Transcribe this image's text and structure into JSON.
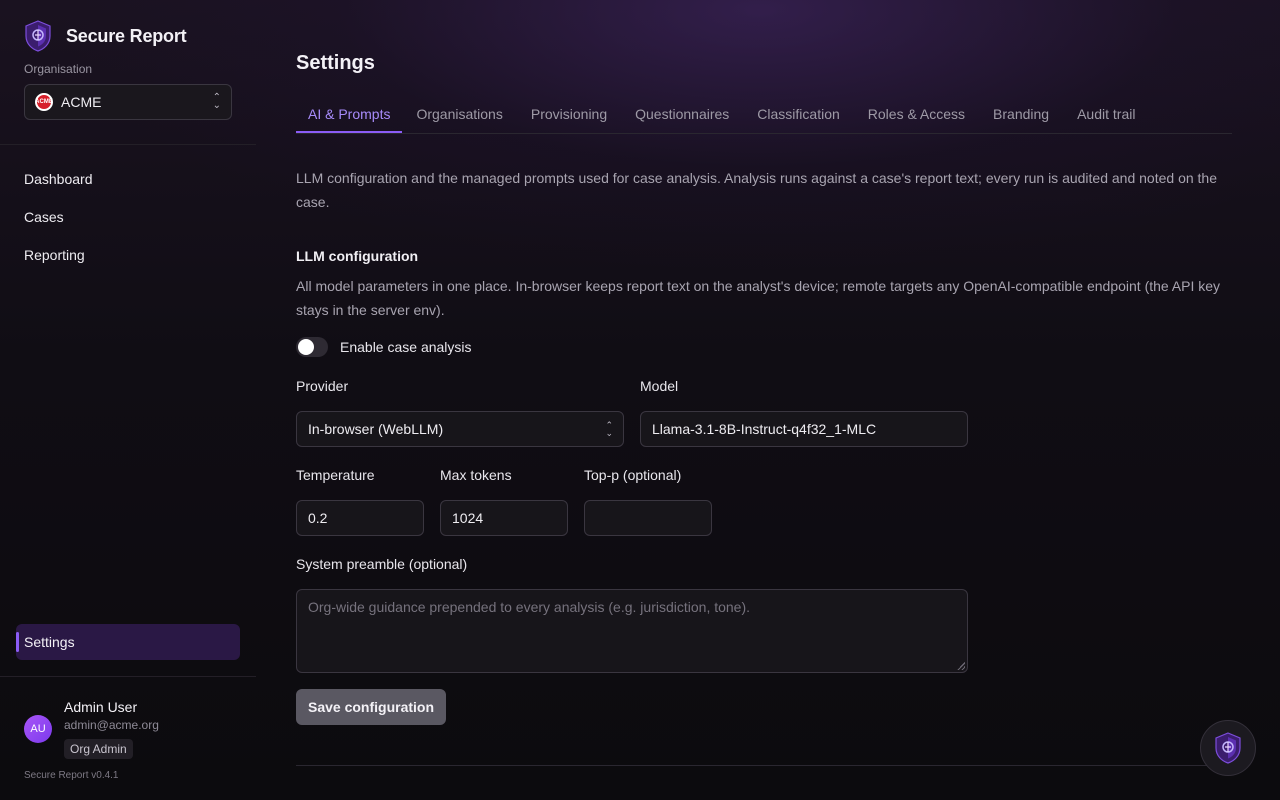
{
  "brand": {
    "name": "Secure Report"
  },
  "sidebar": {
    "org_label": "Organisation",
    "org_selected": "ACME",
    "org_badge_text": "ACME",
    "nav": [
      {
        "label": "Dashboard"
      },
      {
        "label": "Cases"
      },
      {
        "label": "Reporting"
      }
    ],
    "settings_label": "Settings",
    "user": {
      "initials": "AU",
      "name": "Admin User",
      "email": "admin@acme.org",
      "role": "Org Admin"
    },
    "version": "Secure Report v0.4.1"
  },
  "main": {
    "title": "Settings",
    "tabs": [
      {
        "label": "AI & Prompts",
        "active": true
      },
      {
        "label": "Organisations"
      },
      {
        "label": "Provisioning"
      },
      {
        "label": "Questionnaires"
      },
      {
        "label": "Classification"
      },
      {
        "label": "Roles & Access"
      },
      {
        "label": "Branding"
      },
      {
        "label": "Audit trail"
      }
    ],
    "intro": "LLM configuration and the managed prompts used for case analysis. Analysis runs against a case's report text; every run is audited and noted on the case.",
    "llm": {
      "title": "LLM configuration",
      "description": "All model parameters in one place. In-browser keeps report text on the analyst's device; remote targets any OpenAI-compatible endpoint (the API key stays in the server env).",
      "enable_label": "Enable case analysis",
      "enabled": false,
      "provider_label": "Provider",
      "provider_value": "In-browser (WebLLM)",
      "model_label": "Model",
      "model_value": "Llama-3.1-8B-Instruct-q4f32_1-MLC",
      "temperature_label": "Temperature",
      "temperature_value": "0.2",
      "max_tokens_label": "Max tokens",
      "max_tokens_value": "1024",
      "top_p_label": "Top-p (optional)",
      "top_p_value": "",
      "preamble_label": "System preamble (optional)",
      "preamble_placeholder": "Org-wide guidance prepended to every analysis (e.g. jurisdiction, tone).",
      "save_label": "Save configuration"
    }
  },
  "colors": {
    "accent": "#8b5cf6",
    "active_tab": "#a78bfa",
    "org_badge": "#d61e2a"
  },
  "icons": {
    "brand": "shield-logo-icon",
    "org": "acme-badge-icon",
    "select": "chevron-up-down-icon",
    "fab": "shield-logo-icon"
  }
}
